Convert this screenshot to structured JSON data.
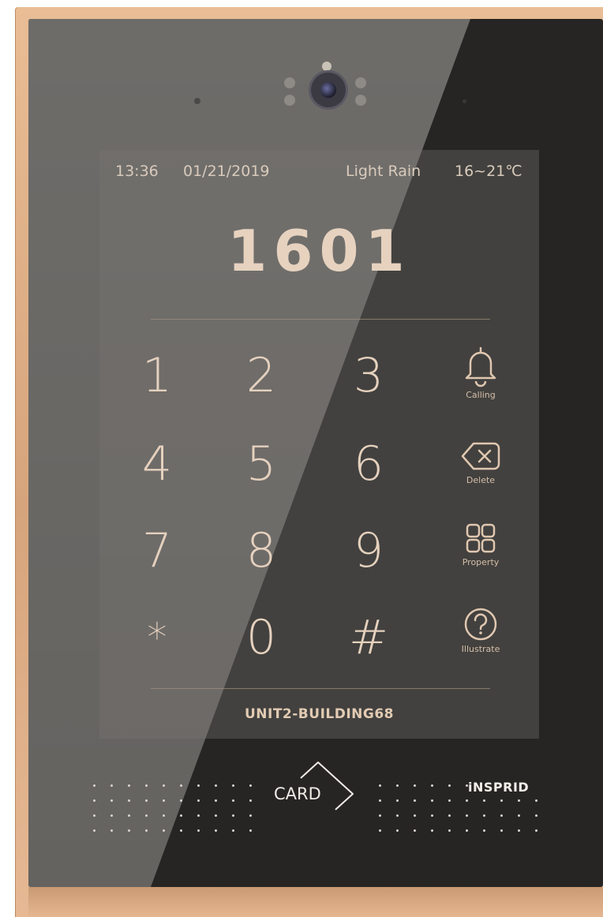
{
  "status": {
    "time": "13:36",
    "date": "01/21/2019",
    "weather": "Light Rain",
    "temperature": "16~21℃"
  },
  "display": {
    "room_number": "1601"
  },
  "keypad": {
    "keys": [
      "1",
      "2",
      "3",
      "4",
      "5",
      "6",
      "7",
      "8",
      "9",
      "*",
      "0",
      "#"
    ],
    "functions": [
      {
        "label": "Calling",
        "icon": "bell-icon"
      },
      {
        "label": "Delete",
        "icon": "backspace-icon"
      },
      {
        "label": "Property",
        "icon": "grid-icon"
      },
      {
        "label": "Illustrate",
        "icon": "help-icon"
      }
    ]
  },
  "footer": {
    "building": "UNIT2-BUILDING68",
    "card_label": "CARD",
    "brand": "iNSPRID"
  },
  "colors": {
    "accent": "#e5d1be",
    "frame": "#d9a882",
    "panel": "#262524"
  }
}
